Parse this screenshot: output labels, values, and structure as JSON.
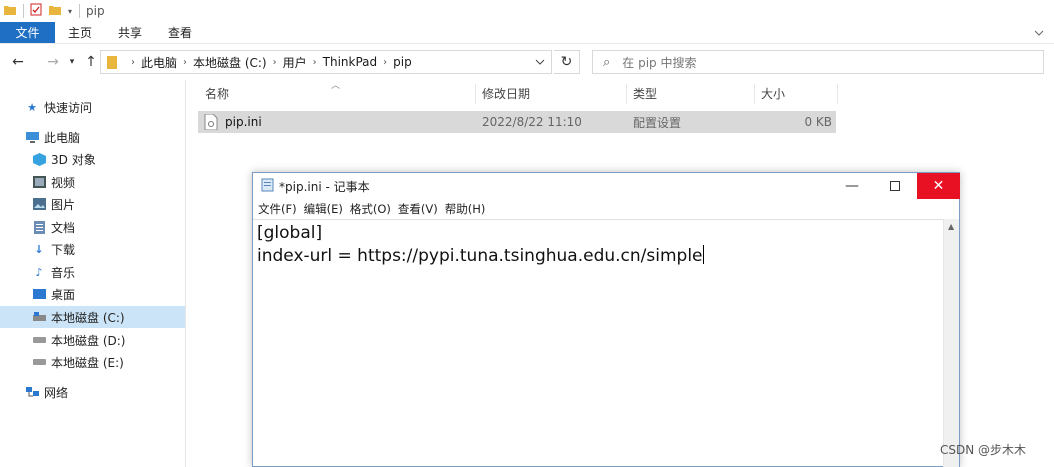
{
  "window": {
    "title": "pip"
  },
  "ribbon": {
    "tabs": [
      "文件",
      "主页",
      "共享",
      "查看"
    ]
  },
  "address": {
    "crumbs": [
      "此电脑",
      "本地磁盘 (C:)",
      "用户",
      "ThinkPad",
      "pip"
    ],
    "search_placeholder": "在 pip 中搜索"
  },
  "sidebar": {
    "quick_access": "快速访问",
    "this_pc": "此电脑",
    "items": [
      "3D 对象",
      "视频",
      "图片",
      "文档",
      "下载",
      "音乐",
      "桌面",
      "本地磁盘 (C:)",
      "本地磁盘 (D:)",
      "本地磁盘 (E:)"
    ],
    "network": "网络"
  },
  "filelist": {
    "columns": [
      "名称",
      "修改日期",
      "类型",
      "大小"
    ],
    "rows": [
      {
        "name": "pip.ini",
        "modified": "2022/8/22 11:10",
        "type": "配置设置",
        "size": "0 KB"
      }
    ]
  },
  "notepad": {
    "title": "*pip.ini - 记事本",
    "menu": [
      "文件(F)",
      "编辑(E)",
      "格式(O)",
      "查看(V)",
      "帮助(H)"
    ],
    "lines": [
      "[global]",
      "index-url = https://pypi.tuna.tsinghua.edu.cn/simple"
    ]
  },
  "watermark": "CSDN @步木木",
  "colors": {
    "file_tab": "#1f6fc5",
    "close_button": "#e81123",
    "selection": "#cce4f7"
  }
}
